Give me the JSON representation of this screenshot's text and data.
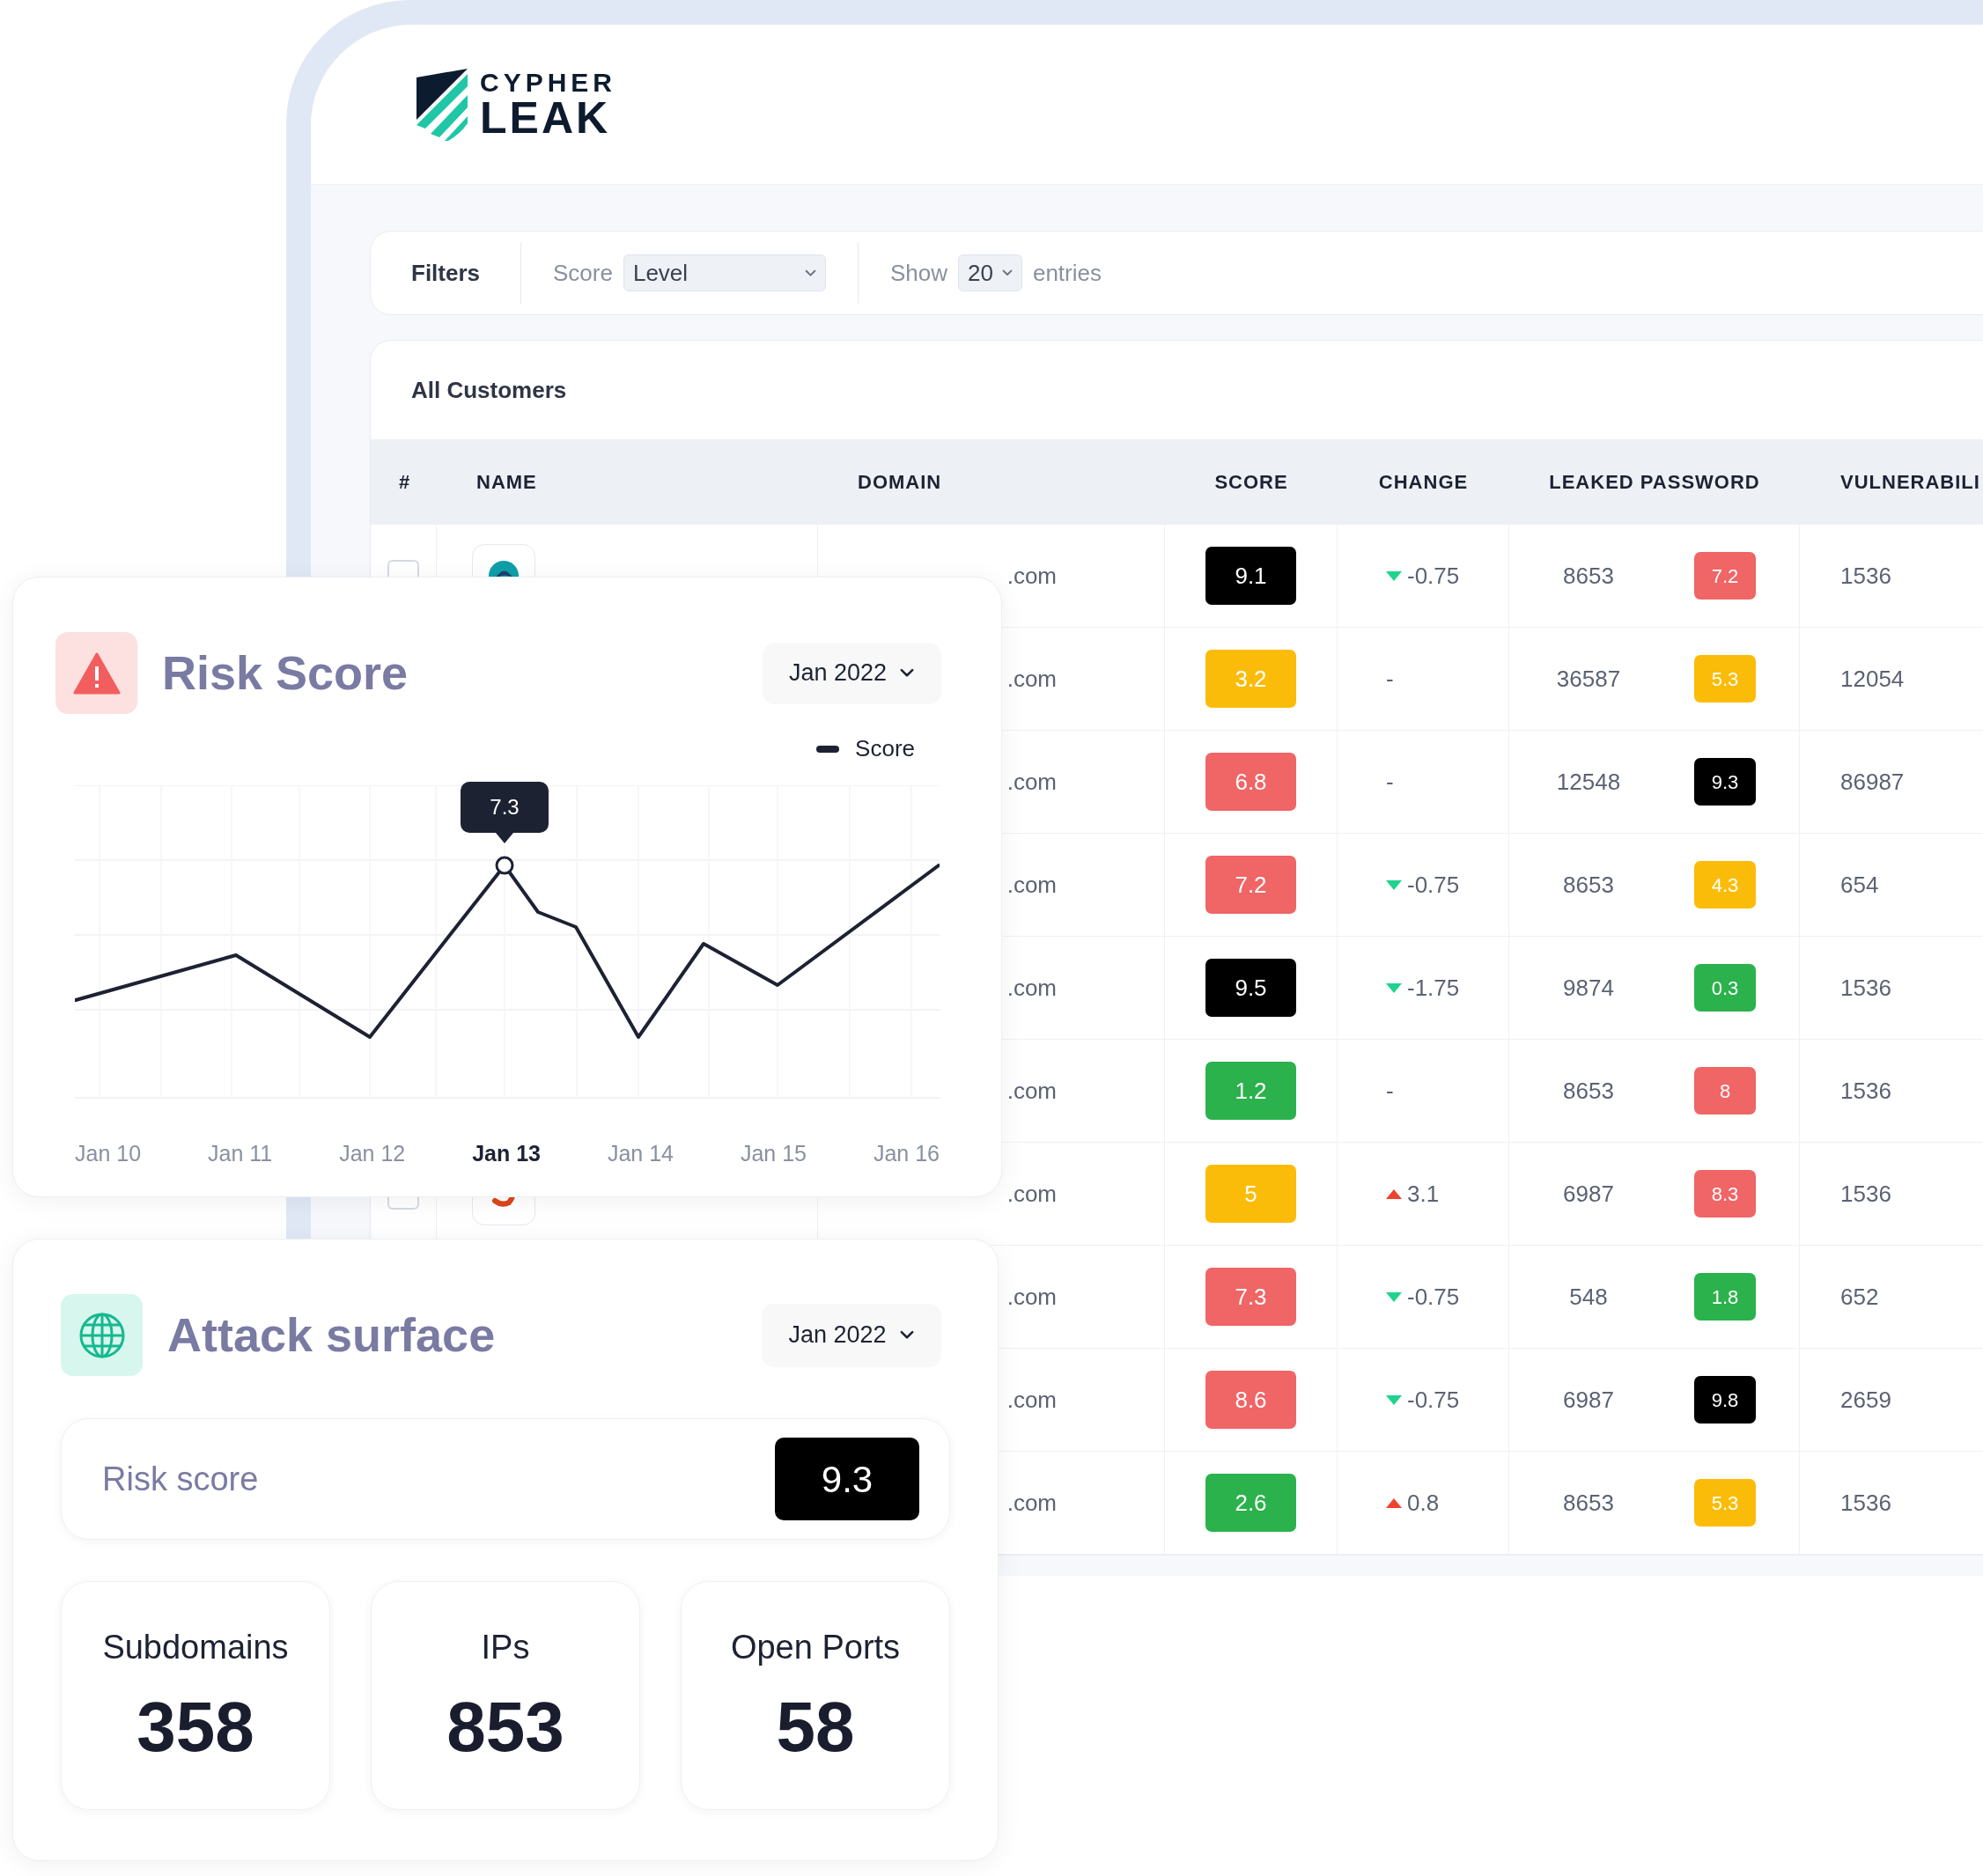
{
  "logo": {
    "line1": "CYPHER",
    "line2": "LEAK"
  },
  "filters": {
    "title": "Filters",
    "score_label": "Score",
    "score_value": "Level",
    "show_label": "Show",
    "show_value": "20",
    "entries_label": "entries"
  },
  "table": {
    "title": "All Customers",
    "columns": [
      "#",
      "NAME",
      "DOMAIN",
      "SCORE",
      "CHANGE",
      "LEAKED PASSWORD",
      "VULNERABILI"
    ],
    "rows": [
      {
        "checked": false,
        "kind": "ring",
        "domain": ".com",
        "score": {
          "text": "9.1",
          "color": "#000000"
        },
        "change": {
          "kind": "down",
          "text": "-0.75"
        },
        "leaked": "8653",
        "leaked_badge": {
          "text": "7.2",
          "color": "#f06565"
        },
        "vulnerability": "1536"
      },
      {
        "domain": ".com",
        "score": {
          "text": "3.2",
          "color": "#fbbc09"
        },
        "change": {
          "kind": "none",
          "text": "-"
        },
        "leaked": "36587",
        "leaked_badge": {
          "text": "5.3",
          "color": "#fbbc09"
        },
        "vulnerability": "12054"
      },
      {
        "domain": ".com",
        "score": {
          "text": "6.8",
          "color": "#f06565"
        },
        "change": {
          "kind": "none",
          "text": "-"
        },
        "leaked": "12548",
        "leaked_badge": {
          "text": "9.3",
          "color": "#000000"
        },
        "vulnerability": "86987"
      },
      {
        "domain": ".com",
        "score": {
          "text": "7.2",
          "color": "#f06565"
        },
        "change": {
          "kind": "down",
          "text": "-0.75"
        },
        "leaked": "8653",
        "leaked_badge": {
          "text": "4.3",
          "color": "#fbbc09"
        },
        "vulnerability": "654"
      },
      {
        "domain": ".com",
        "score": {
          "text": "9.5",
          "color": "#000000"
        },
        "change": {
          "kind": "down",
          "text": "-1.75"
        },
        "leaked": "9874",
        "leaked_badge": {
          "text": "0.3",
          "color": "#2bb24c"
        },
        "vulnerability": "1536"
      },
      {
        "domain": ".com",
        "score": {
          "text": "1.2",
          "color": "#2bb24c"
        },
        "change": {
          "kind": "none",
          "text": "-"
        },
        "leaked": "8653",
        "leaked_badge": {
          "text": "8",
          "color": "#f06565"
        },
        "vulnerability": "1536"
      },
      {
        "checked": false,
        "kind": "hook",
        "domain": ".com",
        "score": {
          "text": "5",
          "color": "#fbbc09"
        },
        "change": {
          "kind": "up",
          "text": "3.1"
        },
        "leaked": "6987",
        "leaked_badge": {
          "text": "8.3",
          "color": "#f06565"
        },
        "vulnerability": "1536"
      },
      {
        "domain": ".com",
        "score": {
          "text": "7.3",
          "color": "#f06565"
        },
        "change": {
          "kind": "down",
          "text": "-0.75"
        },
        "leaked": "548",
        "leaked_badge": {
          "text": "1.8",
          "color": "#2bb24c"
        },
        "vulnerability": "652"
      },
      {
        "domain": ".com",
        "score": {
          "text": "8.6",
          "color": "#f06565"
        },
        "change": {
          "kind": "down",
          "text": "-0.75"
        },
        "leaked": "6987",
        "leaked_badge": {
          "text": "9.8",
          "color": "#000000"
        },
        "vulnerability": "2659"
      },
      {
        "domain": ".com",
        "score": {
          "text": "2.6",
          "color": "#2bb24c"
        },
        "change": {
          "kind": "up",
          "text": "0.8"
        },
        "leaked": "8653",
        "leaked_badge": {
          "text": "5.3",
          "color": "#fbbc09"
        },
        "vulnerability": "1536"
      }
    ]
  },
  "risk_card": {
    "title": "Risk Score",
    "period": "Jan 2022",
    "legend": "Score",
    "tooltip": "7.3",
    "x_labels": [
      {
        "label": "Jan 10",
        "selected": false
      },
      {
        "label": "Jan 11",
        "selected": false
      },
      {
        "label": "Jan 12",
        "selected": false
      },
      {
        "label": "Jan 13",
        "selected": true
      },
      {
        "label": "Jan 14",
        "selected": false
      },
      {
        "label": "Jan 15",
        "selected": false
      },
      {
        "label": "Jan 16",
        "selected": false
      }
    ]
  },
  "attack_card": {
    "title": "Attack surface",
    "period": "Jan 2022",
    "risk_label": "Risk score",
    "risk_value": "9.3",
    "stats": [
      {
        "label": "Subdomains",
        "value": "358"
      },
      {
        "label": "IPs",
        "value": "853"
      },
      {
        "label": "Open Ports",
        "value": "58"
      }
    ]
  }
}
